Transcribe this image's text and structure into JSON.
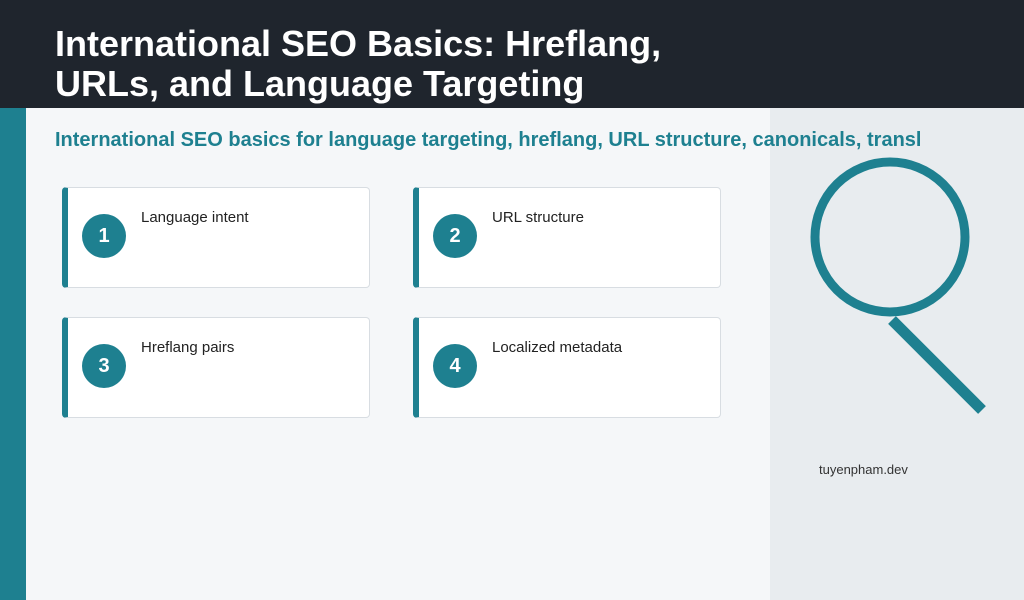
{
  "slide": {
    "title": "International SEO Basics: Hreflang, URLs, and Language Targeting",
    "subtitle": "International SEO basics for language targeting, hreflang, URL structure, canonicals, transl",
    "footer": "tuyenpham.dev",
    "icon": "magnifier-icon",
    "colors": {
      "accent": "#1e8090",
      "title_bar": "#1f252d",
      "panel": "#e8ecef",
      "background": "#f5f7f9"
    }
  },
  "cards": [
    {
      "number": "1",
      "label": "Language intent"
    },
    {
      "number": "2",
      "label": "URL structure"
    },
    {
      "number": "3",
      "label": "Hreflang pairs"
    },
    {
      "number": "4",
      "label": "Localized metadata"
    }
  ]
}
